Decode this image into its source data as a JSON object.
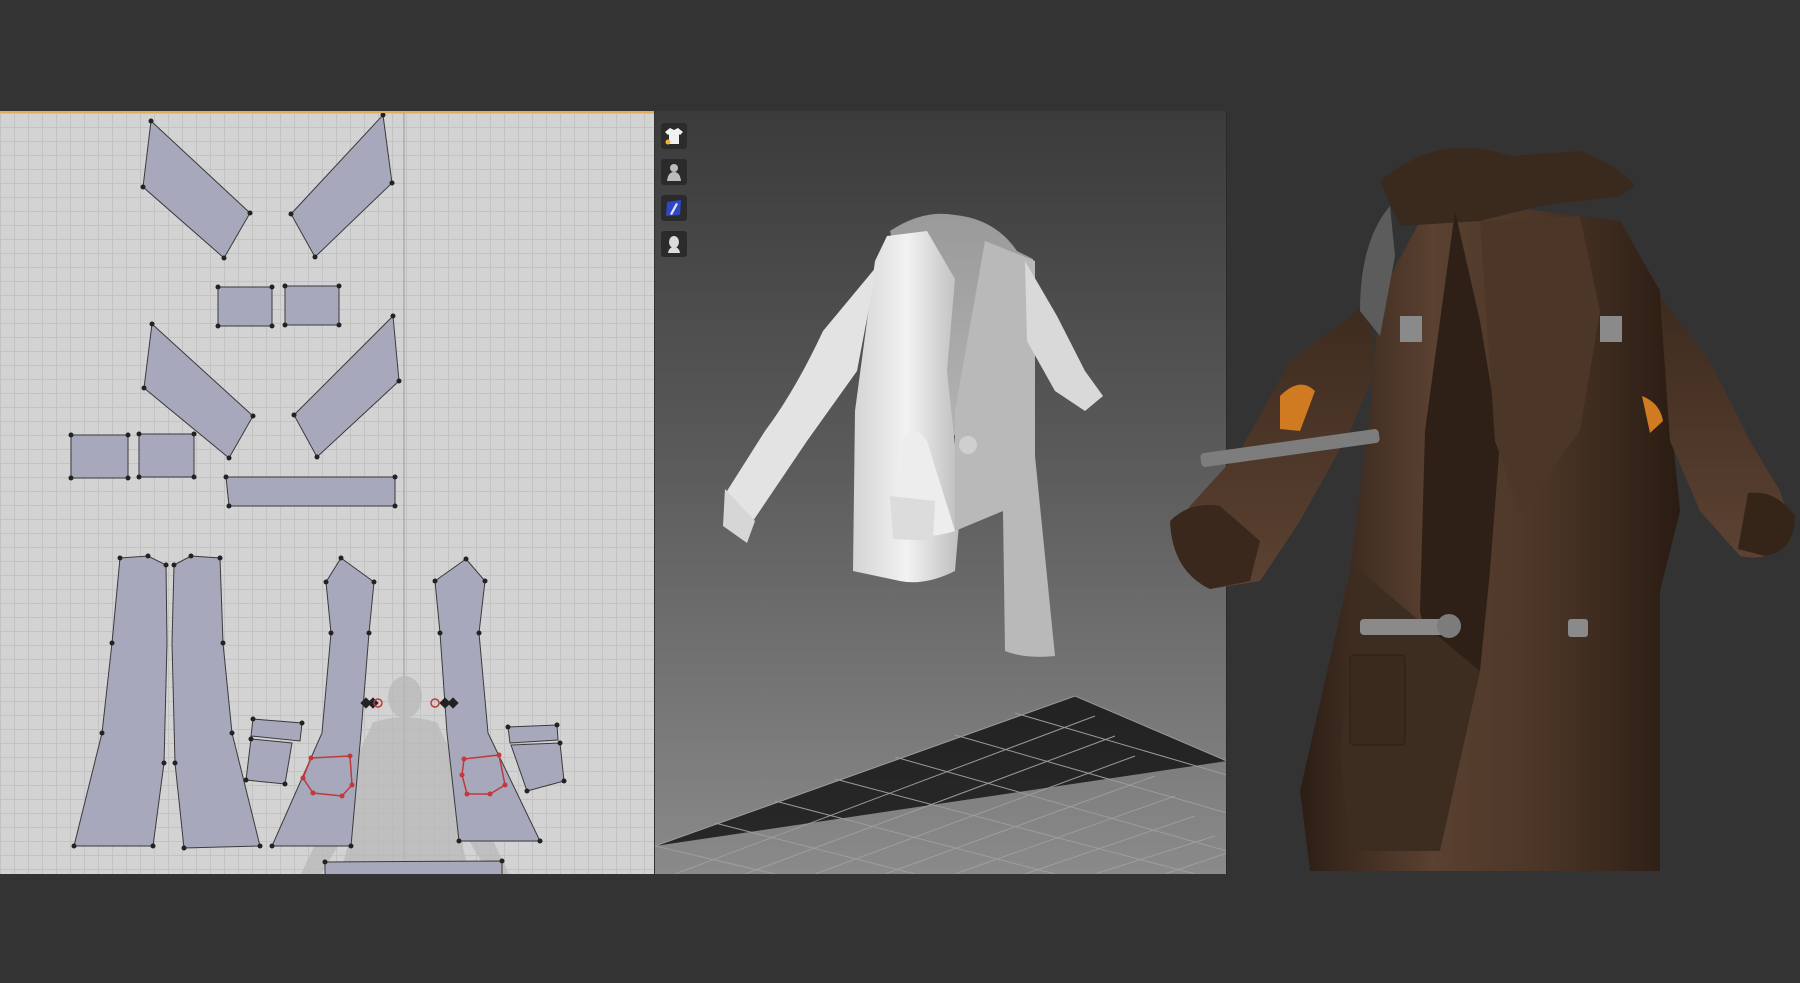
{
  "app": {
    "background": "#333333"
  },
  "pattern_window": {
    "accent": "#e2ad57",
    "grid_color": "#c3c3c3",
    "piece_fill": "#a8a8bc"
  },
  "viewport_3d": {
    "toolbar": [
      {
        "icon": "garment-shirt-icon"
      },
      {
        "icon": "avatar-body-icon"
      },
      {
        "icon": "fabric-texture-icon"
      },
      {
        "icon": "avatar-head-icon"
      }
    ],
    "garment_color": "#e6e6e6"
  },
  "render_view": {
    "coat_color": "#4a3526",
    "patch_color": "#d07a22"
  }
}
